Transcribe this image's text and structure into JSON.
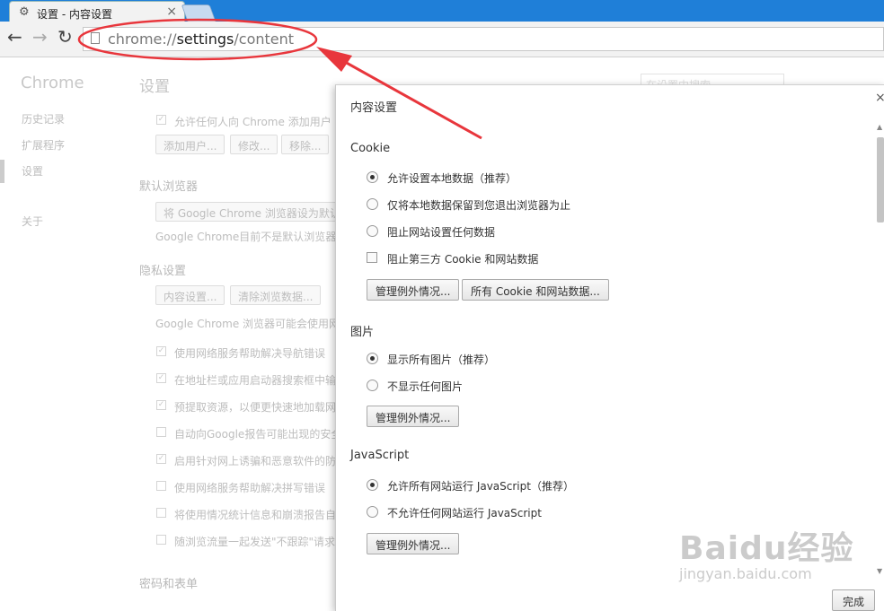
{
  "tab": {
    "title": "设置 - 内容设置"
  },
  "omnibox": {
    "scheme": "chrome://",
    "host": "settings",
    "path": "/content"
  },
  "settings_page": {
    "sidebar": {
      "title": "Chrome",
      "items": [
        "历史记录",
        "扩展程序",
        "设置",
        "关于"
      ]
    },
    "title": "设置",
    "search_placeholder": "在设置中搜索",
    "users": {
      "allow_add": "允许任何人向 Chrome 添加用户",
      "buttons": [
        "添加用户...",
        "修改...",
        "移除..."
      ]
    },
    "default_browser": {
      "heading": "默认浏览器",
      "button": "将 Google Chrome 浏览器设为默认浏",
      "status": "Google Chrome目前不是默认浏览器。"
    },
    "privacy": {
      "heading": "隐私设置",
      "buttons": [
        "内容设置...",
        "清除浏览数据..."
      ],
      "description": "Google Chrome 浏览器可能会使用网络",
      "checkboxes": [
        {
          "label": "使用网络服务帮助解决导航错误",
          "checked": true
        },
        {
          "label": "在地址栏或应用启动器搜索框中输",
          "checked": true
        },
        {
          "label": "预提取资源，以便更快速地加载网",
          "checked": true
        },
        {
          "label": "自动向Google报告可能出现的安全",
          "checked": false
        },
        {
          "label": "启用针对网上诱骗和恶意软件的防",
          "checked": true
        },
        {
          "label": "使用网络服务帮助解决拼写错误",
          "checked": false
        },
        {
          "label": "将使用情况统计信息和崩溃报告自",
          "checked": false
        },
        {
          "label": "随浏览流量一起发送\"不跟踪\"请求",
          "checked": false
        }
      ]
    },
    "passwords": {
      "heading": "密码和表单"
    }
  },
  "dialog": {
    "title": "内容设置",
    "done_label": "完成",
    "cookie": {
      "heading": "Cookie",
      "options": [
        {
          "label": "允许设置本地数据（推荐）",
          "selected": true
        },
        {
          "label": "仅将本地数据保留到您退出浏览器为止",
          "selected": false
        },
        {
          "label": "阻止网站设置任何数据",
          "selected": false
        }
      ],
      "block_third_party": {
        "label": "阻止第三方 Cookie 和网站数据",
        "checked": false
      },
      "exceptions_button": "管理例外情况...",
      "all_cookies_button": "所有 Cookie 和网站数据..."
    },
    "images": {
      "heading": "图片",
      "options": [
        {
          "label": "显示所有图片（推荐）",
          "selected": true
        },
        {
          "label": "不显示任何图片",
          "selected": false
        }
      ],
      "exceptions_button": "管理例外情况..."
    },
    "javascript": {
      "heading": "JavaScript",
      "options": [
        {
          "label": "允许所有网站运行 JavaScript（推荐）",
          "selected": true
        },
        {
          "label": "不允许任何网站运行 JavaScript",
          "selected": false
        }
      ],
      "exceptions_button": "管理例外情况..."
    }
  },
  "watermark": {
    "main": "Baidu经验",
    "sub": "jingyan.baidu.com"
  },
  "colors": {
    "titlebar": "#1f7fd8",
    "annotation": "#e8363c"
  }
}
